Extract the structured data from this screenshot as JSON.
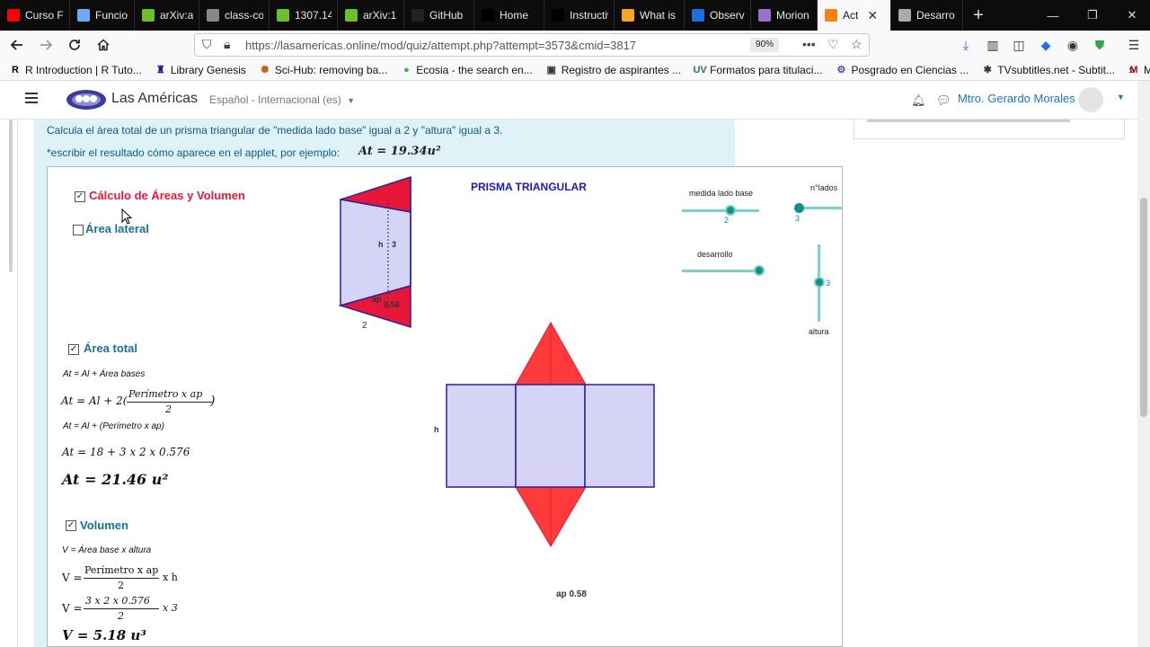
{
  "browser": {
    "tabs": [
      {
        "title": "Curso F",
        "icon": "youtube-icon",
        "color": "#ff0000"
      },
      {
        "title": "Funcio",
        "icon": "link-icon",
        "color": "#6fa8ff"
      },
      {
        "title": "arXiv:a",
        "icon": "arxiv-icon",
        "color": "#6bbf2a"
      },
      {
        "title": "class-code.",
        "icon": "page-icon",
        "color": "#888888"
      },
      {
        "title": "1307.14",
        "icon": "arxiv-icon",
        "color": "#6bbf2a"
      },
      {
        "title": "arXiv:1",
        "icon": "arxiv-icon",
        "color": "#6bbf2a"
      },
      {
        "title": "GitHub",
        "icon": "github-icon",
        "color": "#222222"
      },
      {
        "title": "Home",
        "icon": "home-icon",
        "color": "#000000"
      },
      {
        "title": "Instructivo",
        "icon": "page-icon",
        "color": "#000000"
      },
      {
        "title": "What is",
        "icon": "loading-icon",
        "color": "#f5a623"
      },
      {
        "title": "Observ",
        "icon": "edge-icon",
        "color": "#1e6fd9"
      },
      {
        "title": "Morion",
        "icon": "spinner-icon",
        "color": "#9a6fd0"
      },
      {
        "title": "Act",
        "icon": "moodle-icon",
        "color": "#f98012",
        "active": true
      },
      {
        "title": "Desarro",
        "icon": "spinner-icon",
        "color": "#aaaaaa"
      }
    ],
    "url": "https://lasamericas.online/mod/quiz/attempt.php?attempt=3573&cmid=3817",
    "zoom": "90%",
    "bookmarks": [
      {
        "label": "R Introduction | R Tuto...",
        "icon": "R"
      },
      {
        "label": "Library Genesis",
        "icon": "♜"
      },
      {
        "label": "Sci-Hub: removing ba...",
        "icon": "✺"
      },
      {
        "label": "Ecosia - the search en...",
        "icon": "●"
      },
      {
        "label": "Registro de aspirantes ...",
        "icon": "▣"
      },
      {
        "label": "Formatos para titulaci...",
        "icon": "UV"
      },
      {
        "label": "Posgrado en Ciencias ...",
        "icon": "⚙"
      },
      {
        "label": "TVsubtitles.net - Subtit...",
        "icon": "✱"
      },
      {
        "label": "MEGA",
        "icon": "M"
      }
    ]
  },
  "site": {
    "name": "Las Américas",
    "language": "Español - Internacional (es)",
    "user": "Mtro. Gerardo Morales"
  },
  "question": {
    "text": "Calcula el área total de un prisma triangular de \"medida lado base\" igual a 2 y \"altura\" igual a 3.",
    "note": "*escribir el resultado cómo aparece en el applet, por ejemplo:",
    "example": "At = 19.34u²"
  },
  "applet": {
    "title": "PRISMA TRIANGULAR",
    "chk_calc": "Cálculo de Áreas y Volumen",
    "chk_lateral": "Área lateral",
    "chk_total": "Área total",
    "chk_volumen": "Volumen",
    "total_f1": "At = Al + Área bases",
    "total_f2_lhs": "At = Al + 2(",
    "total_f2_num": "Perímetro x ap",
    "total_f2_den": "2",
    "total_f3": "At = Al + (Perímetro x ap)",
    "total_f4": "At = 18  +  3 x 2 x 0.576",
    "total_result": "At = 21.46 u²",
    "vol_f1": "V = Área base x altura",
    "vol_f2_lhs": "V =",
    "vol_f2_num": "Perímetro x ap",
    "vol_f2_den": "2",
    "vol_f2_rhs": "x h",
    "vol_f3_lhs": "V =",
    "vol_f3_num": "3 x 2 x 0.576",
    "vol_f3_den": "2",
    "vol_f3_rhs": "x 3",
    "vol_result": "V = 5.18 u³",
    "prism_h_label": "h",
    "prism_h_value": "3",
    "prism_ap_label": "ap",
    "prism_ap_value": "0.58",
    "prism_base_value": "2",
    "net_h_label": "h",
    "net_ap_label": "ap 0.58",
    "slider_base_label": "medida lado base",
    "slider_base_value": "2",
    "slider_lados_label": "n°lados",
    "slider_lados_value": "3",
    "slider_desarrollo_label": "desarrollo",
    "slider_altura_label": "altura",
    "slider_altura_value": "3"
  },
  "colors": {
    "moodle_blue": "#1177d1",
    "applet_red": "#e8173a",
    "face_fill": "#d6d4f6",
    "face_stroke": "#2b1f9c",
    "slider_teal": "#0f9188",
    "title_blue": "#1a1ab5"
  }
}
